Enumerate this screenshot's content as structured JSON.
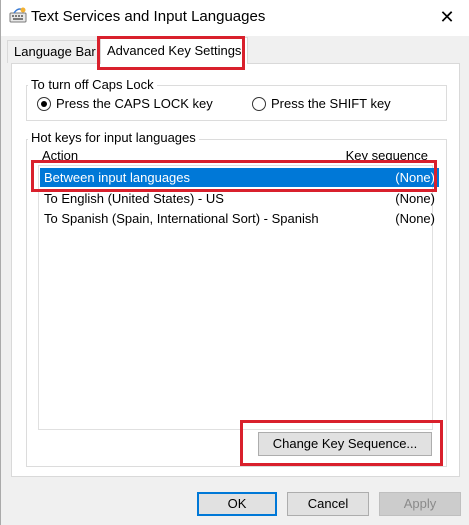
{
  "window": {
    "title": "Text Services and Input Languages",
    "close_label": "✕"
  },
  "tabs": [
    {
      "label": "Language Bar",
      "active": false
    },
    {
      "label": "Advanced Key Settings",
      "active": true
    }
  ],
  "caps_lock": {
    "group_label": "To turn off Caps Lock",
    "options": [
      {
        "label": "Press the CAPS LOCK key",
        "checked": true
      },
      {
        "label": "Press the SHIFT key",
        "checked": false
      }
    ]
  },
  "hotkeys": {
    "group_label": "Hot keys for input languages",
    "columns": {
      "action": "Action",
      "sequence": "Key sequence"
    },
    "rows": [
      {
        "action": "Between input languages",
        "sequence": "(None)",
        "selected": true
      },
      {
        "action": "To English (United States) - US",
        "sequence": "(None)",
        "selected": false
      },
      {
        "action": "To Spanish (Spain, International Sort) - Spanish",
        "sequence": "(None)",
        "selected": false
      }
    ],
    "change_button": "Change Key Sequence..."
  },
  "footer": {
    "ok": "OK",
    "cancel": "Cancel",
    "apply": "Apply"
  },
  "colors": {
    "selection": "#0078d7",
    "highlight": "#d9202c"
  },
  "icons": {
    "app": "keyboard-app-icon",
    "close": "close-icon"
  }
}
